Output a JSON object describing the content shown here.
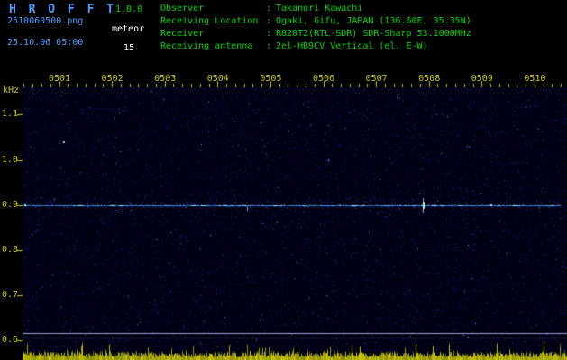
{
  "app": {
    "title": "H R O F F T",
    "version": "1.0.0",
    "filename": "2510060500.png",
    "mode": "meteor",
    "datetime": "25.10.06 05:00",
    "echo_count": "15"
  },
  "station": {
    "separator": ":",
    "rows": [
      {
        "label": "Observer",
        "value": "Takanori Kawachi"
      },
      {
        "label": "Receiving Location",
        "value": "Ogaki, Gifu, JAPAN (136.60E, 35.35N)"
      },
      {
        "label": "Receiver",
        "value": "R820T2(RTL-SDR) SDR-Sharp 53.1000MHz"
      },
      {
        "label": "Receiving antenna",
        "value": "2el-HB9CV Vertical (el. E-W)"
      }
    ]
  },
  "chart_data": {
    "type": "heatmap",
    "x_ticks": [
      "0501",
      "0502",
      "0503",
      "0504",
      "0505",
      "0506",
      "0507",
      "0508",
      "0509",
      "0510"
    ],
    "ylabel": "kHz",
    "y_ticks": [
      1.1,
      1.0,
      0.9,
      0.8,
      0.7,
      0.6
    ],
    "ylim": [
      0.56,
      1.17
    ],
    "grid": false,
    "carrier_line_khz": 0.9,
    "separator_lines_khz": [
      0.615,
      0.605
    ],
    "noise_strip": {
      "position": "bottom",
      "color": "yellow"
    },
    "notable_echoes": [
      {
        "t_min": 0.35,
        "khz": 0.9,
        "kind": "dot"
      },
      {
        "t_min": 1.07,
        "khz": 1.04,
        "kind": "dot"
      },
      {
        "t_min": 4.55,
        "khz": 0.895,
        "kind": "dash"
      },
      {
        "t_min": 7.89,
        "khz": 0.9,
        "kind": "spike"
      },
      {
        "t_min": 9.17,
        "khz": 0.9,
        "kind": "dot"
      }
    ]
  },
  "colors": {
    "background": "#000000",
    "plot_background": "#000014",
    "title_blue": "#4aa0ff",
    "info_green": "#00d800",
    "white": "#ffffff",
    "axis_yellow": "#c8c800",
    "noise_blue": "#1e50c8",
    "carrier_blue": "#5aaaff",
    "bright_cyan": "#a0e4ff",
    "noise_strip_yellow": "#cdcd00",
    "separator_line": "#c8d0ff"
  }
}
